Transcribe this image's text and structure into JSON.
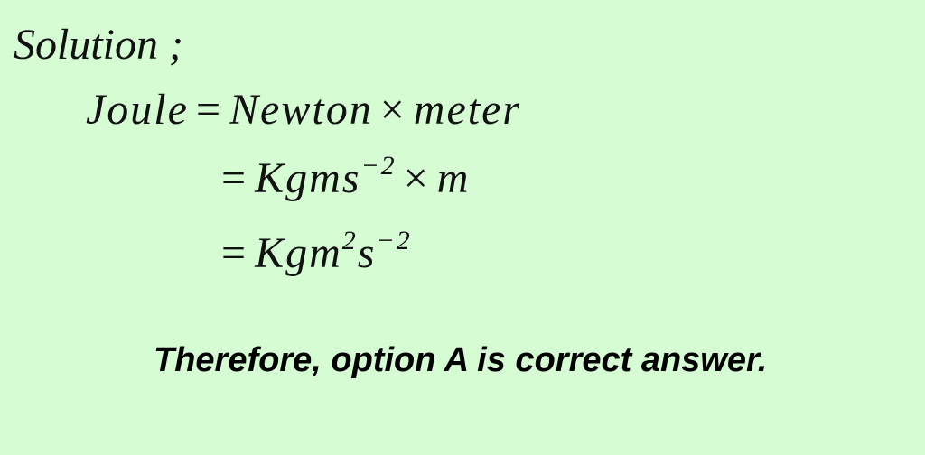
{
  "heading": "Solution ;",
  "equations": [
    {
      "lhs": "Joule",
      "op": "=",
      "rhs": [
        "Newton",
        "×",
        "meter"
      ]
    },
    {
      "op": "=",
      "base": "Kgms",
      "exp": "−2",
      "times": "×",
      "tail": "m"
    },
    {
      "op": "=",
      "base1": "Kgm",
      "exp1": "2",
      "base2": "s",
      "exp2": "−2"
    }
  ],
  "conclusion": "Therefore, option A is correct answer."
}
